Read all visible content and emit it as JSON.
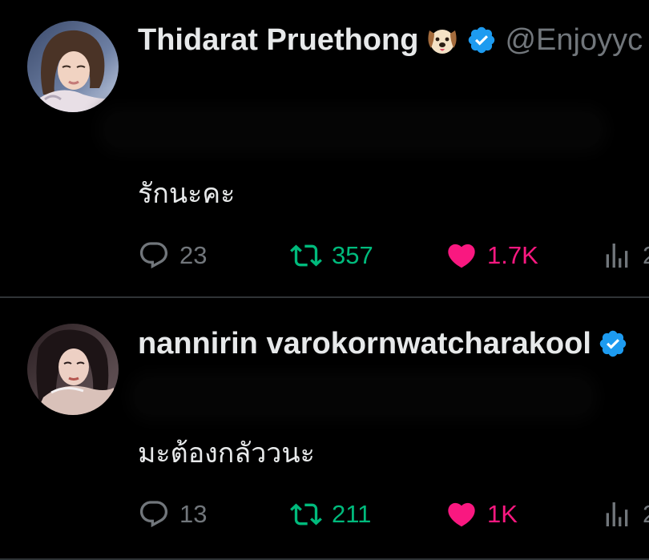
{
  "colors": {
    "background": "#000000",
    "text": "#e7e9ea",
    "muted": "#71767b",
    "verified": "#1d9bf0",
    "retweet": "#00ba7c",
    "like": "#f91880",
    "divider": "#2f3336"
  },
  "tweets": [
    {
      "display_name": "Thidarat Pruethong",
      "name_emoji": "dog-face-emoji",
      "verified_icon": "verified-badge-icon",
      "handle": "@Enjoyyc",
      "text": "รักนะคะ",
      "reply_count": "23",
      "retweet_count": "357",
      "like_count": "1.7K",
      "views_count": "2"
    },
    {
      "display_name": "nannirin varokornwatcharakool",
      "verified_icon": "verified-badge-icon",
      "text": "มะต้องกลัววนะ",
      "reply_count": "13",
      "retweet_count": "211",
      "like_count": "1K",
      "views_count": "2"
    }
  ]
}
